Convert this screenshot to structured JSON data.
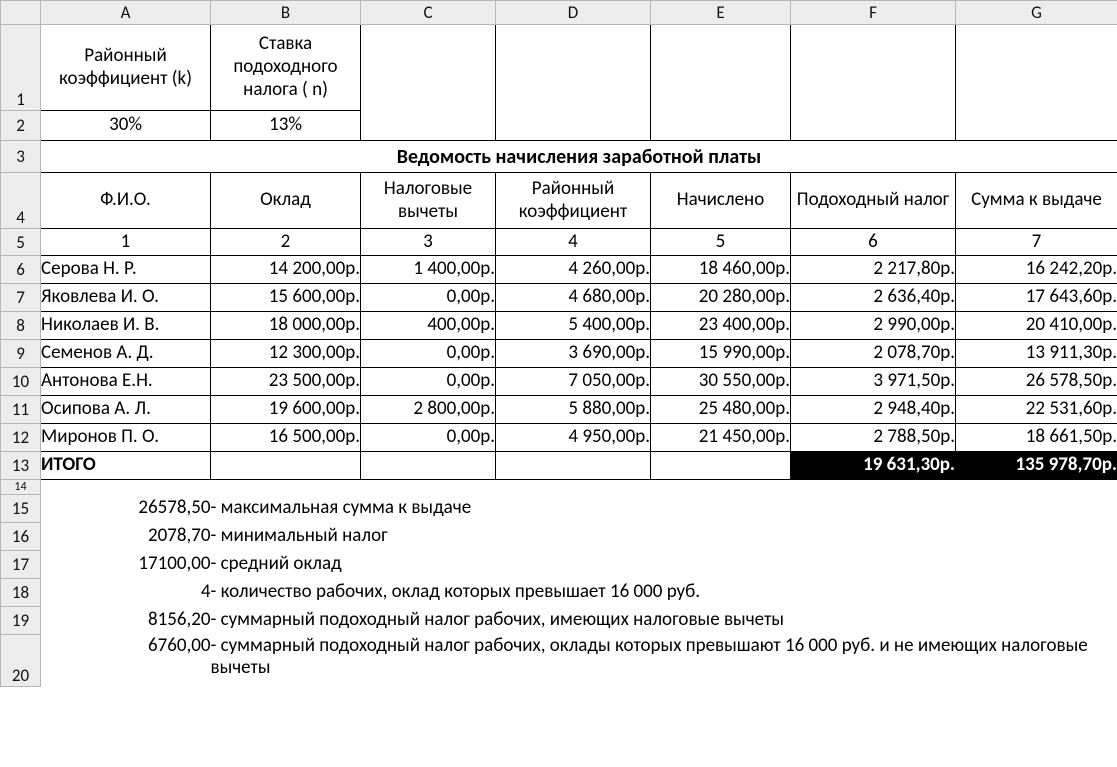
{
  "columns": [
    "A",
    "B",
    "C",
    "D",
    "E",
    "F",
    "G"
  ],
  "rows": [
    "1",
    "2",
    "3",
    "4",
    "5",
    "6",
    "7",
    "8",
    "9",
    "10",
    "11",
    "12",
    "13",
    "14",
    "15",
    "16",
    "17",
    "18",
    "19",
    "20"
  ],
  "header": {
    "A1": "Районный коэффициент (k)",
    "B1": "Ставка подоходного налога ( n)",
    "A2": "30%",
    "B2": "13%"
  },
  "title": "Ведомость начисления заработной платы",
  "thead": {
    "A": "Ф.И.О.",
    "B": "Оклад",
    "C": "Налоговые вычеты",
    "D": "Районный коэффициент",
    "E": "Начислено",
    "F": "Подоходный налог",
    "G": "Сумма к выдаче"
  },
  "tnum": {
    "A": "1",
    "B": "2",
    "C": "3",
    "D": "4",
    "E": "5",
    "F": "6",
    "G": "7"
  },
  "data": [
    {
      "name": "Серова Н. Р.",
      "b": "14 200,00р.",
      "c": "1 400,00р.",
      "d": "4 260,00р.",
      "e": "18 460,00р.",
      "f": "2 217,80р.",
      "g": "16 242,20р."
    },
    {
      "name": "Яковлева И. О.",
      "b": "15 600,00р.",
      "c": "0,00р.",
      "d": "4 680,00р.",
      "e": "20 280,00р.",
      "f": "2 636,40р.",
      "g": "17 643,60р."
    },
    {
      "name": "Николаев И. В.",
      "b": "18 000,00р.",
      "c": "400,00р.",
      "d": "5 400,00р.",
      "e": "23 400,00р.",
      "f": "2 990,00р.",
      "g": "20 410,00р."
    },
    {
      "name": "Семенов А. Д.",
      "b": "12 300,00р.",
      "c": "0,00р.",
      "d": "3 690,00р.",
      "e": "15 990,00р.",
      "f": "2 078,70р.",
      "g": "13 911,30р."
    },
    {
      "name": "Антонова Е.Н.",
      "b": "23 500,00р.",
      "c": "0,00р.",
      "d": "7 050,00р.",
      "e": "30 550,00р.",
      "f": "3 971,50р.",
      "g": "26 578,50р."
    },
    {
      "name": "Осипова А. Л.",
      "b": "19 600,00р.",
      "c": "2 800,00р.",
      "d": "5 880,00р.",
      "e": "25 480,00р.",
      "f": "2 948,40р.",
      "g": "22 531,60р."
    },
    {
      "name": "Миронов П. О.",
      "b": "16 500,00р.",
      "c": "0,00р.",
      "d": "4 950,00р.",
      "e": "21 450,00р.",
      "f": "2 788,50р.",
      "g": "18 661,50р."
    }
  ],
  "total": {
    "label": "ИТОГО",
    "f": "19 631,30р.",
    "g": "135 978,70р."
  },
  "stats": [
    {
      "v": "26578,50",
      "t": " - максимальная сумма к выдаче"
    },
    {
      "v": "2078,70",
      "t": " - минимальный налог"
    },
    {
      "v": "17100,00",
      "t": " - средний оклад"
    },
    {
      "v": "4",
      "t": " - количество рабочих, оклад которых превышает 16 000 руб."
    },
    {
      "v": "8156,20",
      "t": " - суммарный подоходный налог рабочих, имеющих налоговые вычеты"
    },
    {
      "v": "6760,00",
      "t": " - суммарный подоходный налог рабочих, оклады которых превышают 16 000 руб. и не имеющих налоговые вычеты"
    }
  ]
}
